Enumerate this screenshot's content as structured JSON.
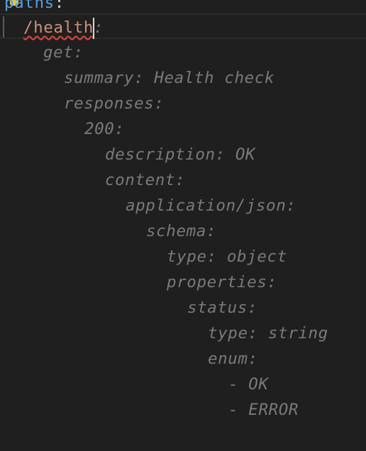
{
  "editor": {
    "line_paths": {
      "key": "paths",
      "colon": ":"
    },
    "line_health": {
      "path_a": "/health",
      "path_b": "",
      "colon": ":"
    },
    "ghost_lines": [
      "get:",
      "summary: Health check",
      "responses:",
      "200:",
      "description: OK",
      "content:",
      "application/json:",
      "schema:",
      "type: object",
      "properties:",
      "status:",
      "type: string",
      "enum:",
      "- OK",
      "- ERROR"
    ],
    "colors": {
      "background": "#1f1f1f",
      "key_blue": "#5aa0dc",
      "key_orange": "#ce9178",
      "ghost_text": "#7a7a7a",
      "error_squiggle": "#e0443b",
      "lightbulb": "#e2c04a"
    },
    "icons": {
      "lightbulb": "lightbulb-icon"
    }
  }
}
